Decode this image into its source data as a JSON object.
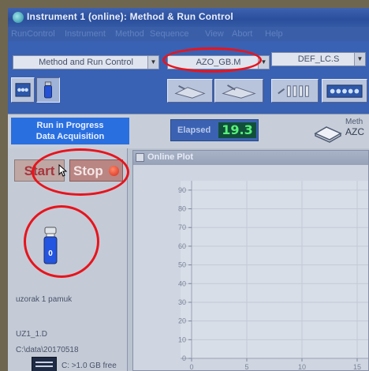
{
  "window": {
    "title": "Instrument 1 (online): Method & Run Control"
  },
  "menu": [
    "RunControl",
    "Instrument",
    "Method",
    "Sequence",
    "View",
    "Abort",
    "Help"
  ],
  "toolbar": {
    "view_select": "Method and Run Control",
    "method_select": "AZO_GB.M",
    "sequence_select": "DEF_LC.S"
  },
  "status": {
    "run_line1": "Run in Progress",
    "run_line2": "Data Acquisition",
    "elapsed_label": "Elapsed",
    "elapsed_value": "19.3",
    "method_label": "Meth",
    "method_name": "AZC"
  },
  "left_panel": {
    "start_label": "Start",
    "stop_label": "Stop",
    "vial_number": "0",
    "sample_name": "uzorak 1 pamuk",
    "data_file": "UZ1_1.D",
    "data_path": "C:\\data\\20170518",
    "disk_free": "C: >1.0 GB free"
  },
  "plot": {
    "title": "Online Plot"
  },
  "chart_data": {
    "type": "line",
    "title": "",
    "xlabel": "",
    "ylabel": "",
    "xlim": [
      -1,
      16
    ],
    "ylim": [
      0,
      95
    ],
    "x_ticks": [
      0,
      5,
      10,
      15
    ],
    "y_ticks": [
      0,
      10,
      20,
      30,
      40,
      50,
      60,
      70,
      80,
      90
    ],
    "grid": true,
    "series": []
  },
  "colors": {
    "accent": "#2a6fe0",
    "stop": "#d62a1a",
    "elapsed": "#57f07a",
    "highlight": "#e8141c"
  }
}
